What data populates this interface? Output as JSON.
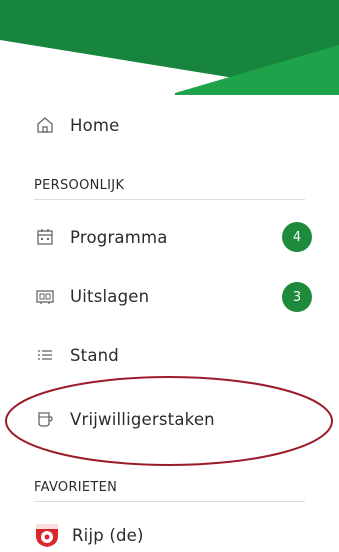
{
  "colors": {
    "brand_green": "#1e8a3c",
    "banner_dark_green": "#16853d",
    "banner_light_green": "#1ea24a",
    "highlight_ellipse": "#9b1b2a"
  },
  "nav": {
    "home": {
      "label": "Home",
      "icon": "home-icon"
    },
    "sections": [
      {
        "title": "PERSOONLIJK",
        "items": [
          {
            "label": "Programma",
            "icon": "calendar-icon",
            "badge": "4"
          },
          {
            "label": "Uitslagen",
            "icon": "scoreboard-icon",
            "badge": "3"
          },
          {
            "label": "Stand",
            "icon": "list-icon"
          },
          {
            "label": "Vrijwilligerstaken",
            "icon": "cup-icon"
          }
        ]
      },
      {
        "title": "FAVORIETEN",
        "items": [
          {
            "label": "Rijp (de)",
            "icon": "club-logo-icon"
          }
        ]
      }
    ]
  }
}
